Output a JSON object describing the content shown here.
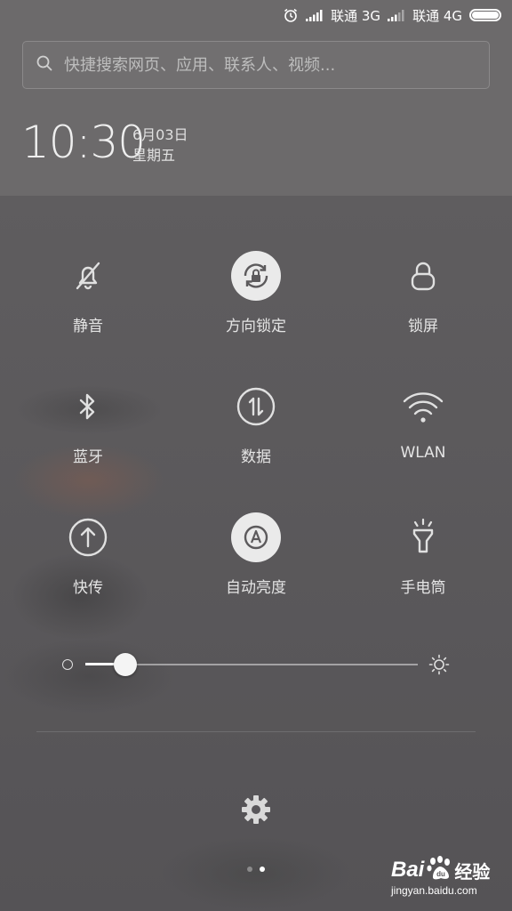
{
  "status_bar": {
    "carrier1": "联通 3G",
    "carrier2": "联通 4G",
    "icons": [
      "alarm-icon",
      "signal-icon",
      "signal-icon",
      "battery-icon"
    ]
  },
  "search": {
    "placeholder": "快捷搜索网页、应用、联系人、视频..."
  },
  "clock": {
    "time": "10:30",
    "date": "6月03日",
    "weekday": "星期五"
  },
  "toggles": [
    {
      "label": "静音",
      "icon": "bell-off-icon",
      "active": false
    },
    {
      "label": "方向锁定",
      "icon": "rotation-lock-icon",
      "active": true
    },
    {
      "label": "锁屏",
      "icon": "lock-icon",
      "active": false
    },
    {
      "label": "蓝牙",
      "icon": "bluetooth-icon",
      "active": false
    },
    {
      "label": "数据",
      "icon": "data-icon",
      "active": false
    },
    {
      "label": "WLAN",
      "icon": "wifi-icon",
      "active": false
    },
    {
      "label": "快传",
      "icon": "upload-icon",
      "active": false
    },
    {
      "label": "自动亮度",
      "icon": "auto-brightness-icon",
      "active": true
    },
    {
      "label": "手电筒",
      "icon": "flashlight-icon",
      "active": false
    }
  ],
  "brightness": {
    "level": 0.12
  },
  "pager": {
    "count": 2,
    "active_index": 1
  },
  "watermark": {
    "brand": "Bai",
    "brand_suffix": "经验",
    "url": "jingyan.baidu.com"
  },
  "colors": {
    "active_circle": "#eaeaea",
    "panel_bg": "#5a585a"
  }
}
